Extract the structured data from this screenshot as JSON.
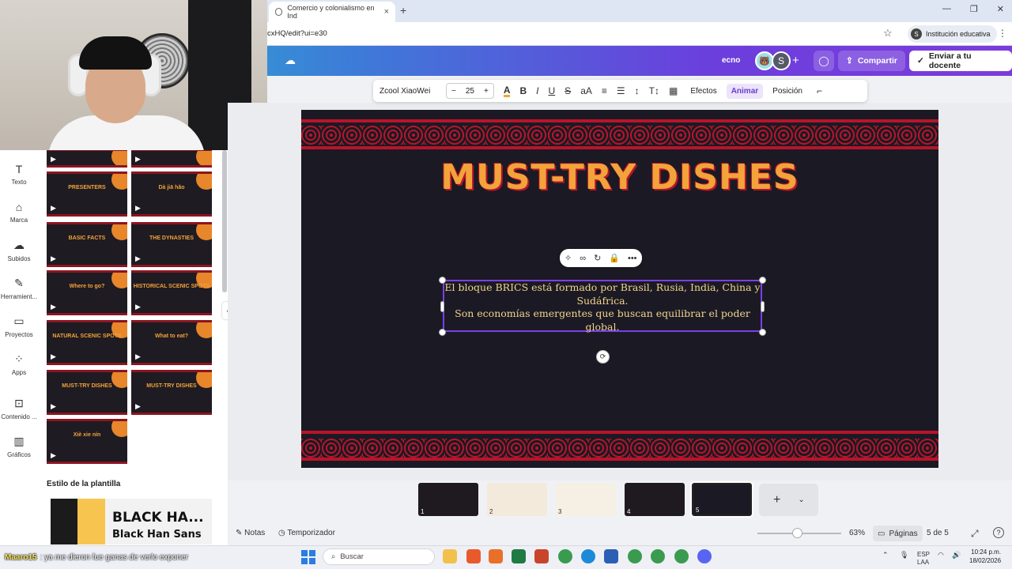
{
  "browser": {
    "tab_title": "Comercio y colonialismo en Ind",
    "url": "cxHQ/edit?ui=e30",
    "profile_label": "Institución educativa",
    "profile_initial": "S"
  },
  "header": {
    "partial_text": "ecno",
    "avatar_initial": "S",
    "share_label": "Compartir",
    "send_label": "Enviar a tu docente"
  },
  "rail": {
    "items": [
      {
        "label": "Texto",
        "icon": "text-icon"
      },
      {
        "label": "Marca",
        "icon": "brand-icon"
      },
      {
        "label": "Subidos",
        "icon": "upload-cloud-icon"
      },
      {
        "label": "Herramient...",
        "icon": "tools-icon"
      },
      {
        "label": "Proyectos",
        "icon": "folder-icon"
      },
      {
        "label": "Apps",
        "icon": "apps-icon"
      },
      {
        "label": "Contenido ...",
        "icon": "content-icon"
      },
      {
        "label": "Gráficos",
        "icon": "chart-icon"
      }
    ]
  },
  "templates": {
    "thumbs": [
      {
        "title": ""
      },
      {
        "title": ""
      },
      {
        "title": "PRESENTERS"
      },
      {
        "title": "Dà jiā hǎo"
      },
      {
        "title": "BASIC FACTS"
      },
      {
        "title": "THE DYNASTIES"
      },
      {
        "title": "Where to go?"
      },
      {
        "title": "HISTORICAL SCENIC SPOTS"
      },
      {
        "title": "NATURAL SCENIC SPOTS"
      },
      {
        "title": "What to eat?"
      },
      {
        "title": "MUST-TRY DISHES"
      },
      {
        "title": "MUST-TRY DISHES"
      },
      {
        "title": "Xiè xie nín"
      }
    ],
    "style_heading": "Estilo de la plantilla",
    "font_heading": "BLACK HA...",
    "font_name": "Black Han Sans"
  },
  "toolbar": {
    "font": "Zcool XiaoWei",
    "minus": "−",
    "size": "25",
    "plus": "+",
    "effects": "Efectos",
    "animate": "Animar",
    "position": "Posición"
  },
  "slide": {
    "title": "MUST-TRY DISHES",
    "body_line1": "El bloque BRICS está formado por Brasil, Rusia, India, China y",
    "body_line2": "Sudáfrica.",
    "body_line3": "Son economías emergentes que buscan equilibrar el poder global."
  },
  "pages": {
    "thumbs": [
      {
        "num": "1",
        "bg": "#1e1a20"
      },
      {
        "num": "2",
        "bg": "#f3eadc"
      },
      {
        "num": "3",
        "bg": "#f6efe3"
      },
      {
        "num": "4",
        "bg": "#1e1a20"
      },
      {
        "num": "5",
        "bg": "#1b1a24"
      }
    ],
    "add": "+"
  },
  "footer": {
    "notes": "Notas",
    "timer": "Temporizador",
    "zoom": "63%",
    "pages_label": "Páginas",
    "page_count": "5 de 5"
  },
  "taskbar": {
    "chat_user": "Maaro15",
    "chat_message": ": ya me dieron fue ganas de verlo exponer",
    "search_placeholder": "Buscar",
    "lang": "ESP",
    "lang2": "LAA",
    "time": "10:24 p.m.",
    "date": "18/02/2026"
  },
  "colors": {
    "accent": "#7b3fe4",
    "slide_bg": "#1b1a24",
    "title_orange": "#f2a33a",
    "border_red": "#b8142a"
  }
}
